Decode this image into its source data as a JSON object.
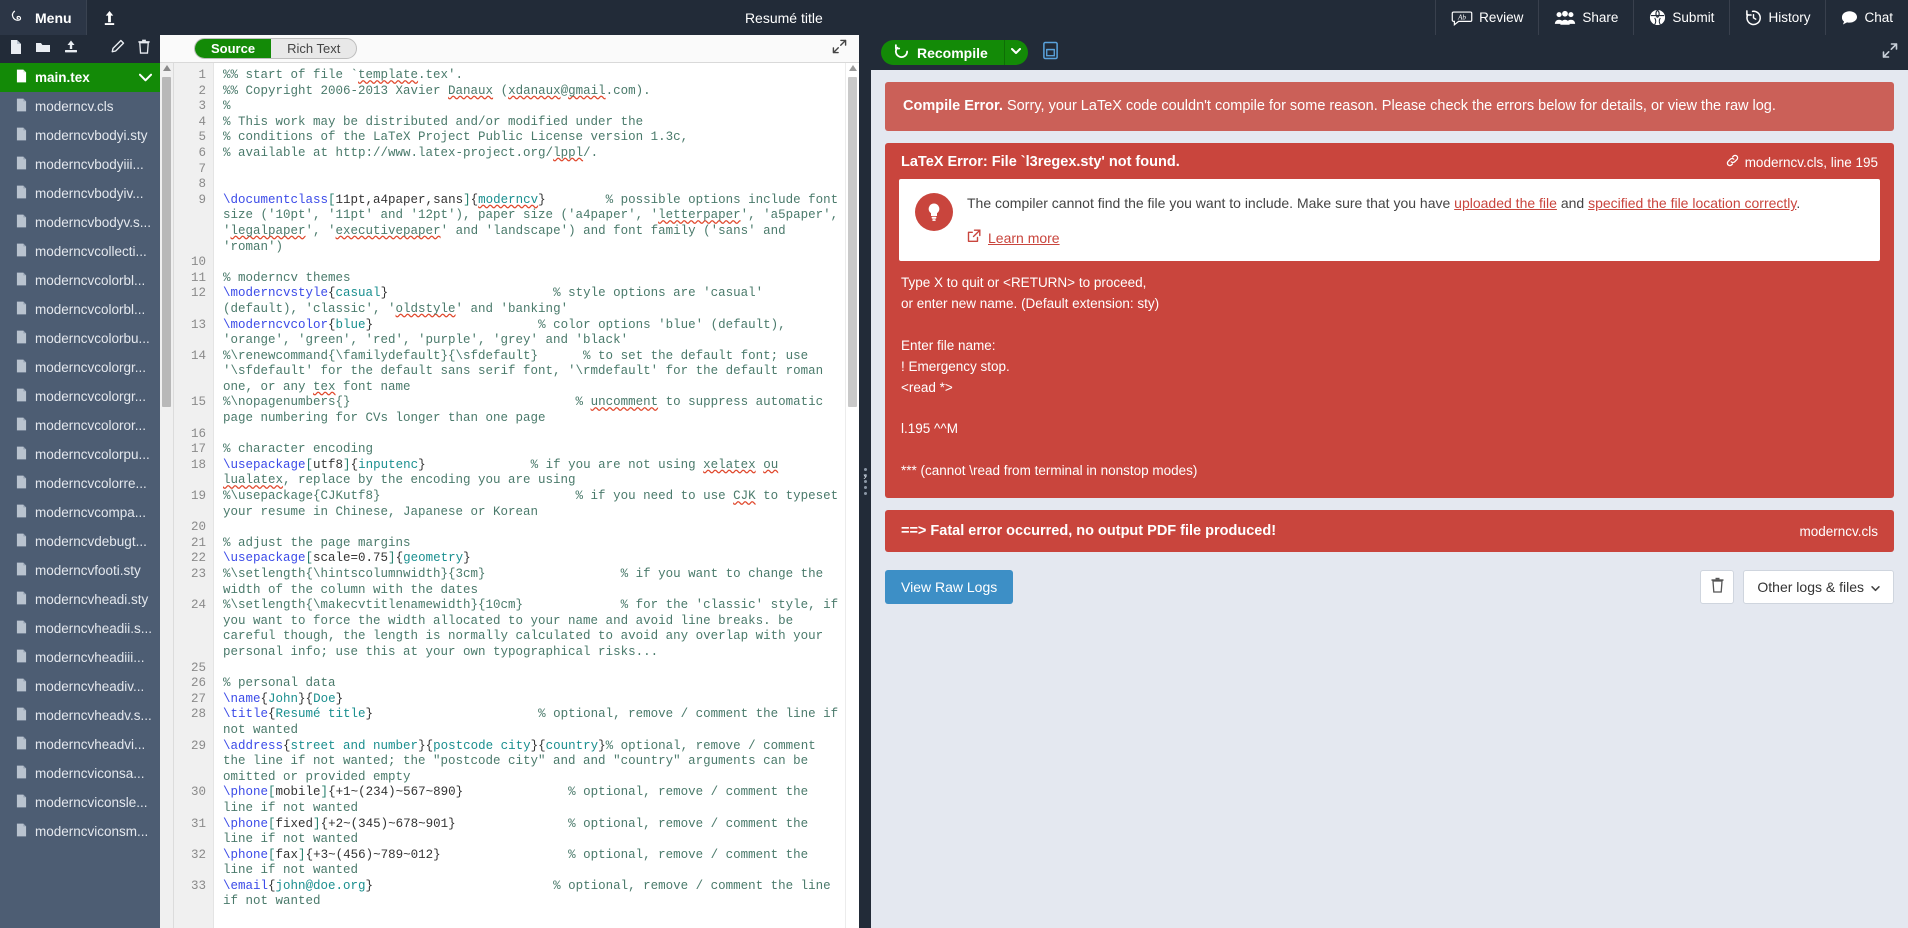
{
  "topnav": {
    "menu_label": "Menu",
    "back_icon": "upload-arrow-icon",
    "project_title": "Resumé title",
    "buttons": [
      {
        "label": "Review",
        "icon": "review-ab-icon"
      },
      {
        "label": "Share",
        "icon": "people-icon"
      },
      {
        "label": "Submit",
        "icon": "globe-icon"
      },
      {
        "label": "History",
        "icon": "history-clock-icon"
      },
      {
        "label": "Chat",
        "icon": "chat-bubble-icon"
      }
    ]
  },
  "filetree": {
    "toolbar": [
      {
        "icon": "new-file-icon"
      },
      {
        "icon": "new-folder-icon"
      },
      {
        "icon": "upload-icon"
      },
      {
        "icon": "rename-pencil-icon"
      },
      {
        "icon": "delete-trash-icon"
      }
    ],
    "items": [
      {
        "name": "main.tex",
        "selected": true
      },
      {
        "name": "moderncv.cls",
        "selected": false
      },
      {
        "name": "moderncvbodyi.sty",
        "selected": false
      },
      {
        "name": "moderncvbodyiii...",
        "selected": false
      },
      {
        "name": "moderncvbodyiv...",
        "selected": false
      },
      {
        "name": "moderncvbodyv.s...",
        "selected": false
      },
      {
        "name": "moderncvcollecti...",
        "selected": false
      },
      {
        "name": "moderncvcolorbl...",
        "selected": false
      },
      {
        "name": "moderncvcolorbl...",
        "selected": false
      },
      {
        "name": "moderncvcolorbu...",
        "selected": false
      },
      {
        "name": "moderncvcolorgr...",
        "selected": false
      },
      {
        "name": "moderncvcolorgr...",
        "selected": false
      },
      {
        "name": "moderncvcoloror...",
        "selected": false
      },
      {
        "name": "moderncvcolorpu...",
        "selected": false
      },
      {
        "name": "moderncvcolorre...",
        "selected": false
      },
      {
        "name": "moderncvcompa...",
        "selected": false
      },
      {
        "name": "moderncvdebugt...",
        "selected": false
      },
      {
        "name": "moderncvfooti.sty",
        "selected": false
      },
      {
        "name": "moderncvheadi.sty",
        "selected": false
      },
      {
        "name": "moderncvheadii.s...",
        "selected": false
      },
      {
        "name": "moderncvheadiii...",
        "selected": false
      },
      {
        "name": "moderncvheadiv...",
        "selected": false
      },
      {
        "name": "moderncvheadv.s...",
        "selected": false
      },
      {
        "name": "moderncvheadvi...",
        "selected": false
      },
      {
        "name": "moderncviconsa...",
        "selected": false
      },
      {
        "name": "moderncviconsle...",
        "selected": false
      },
      {
        "name": "moderncviconsm...",
        "selected": false
      }
    ]
  },
  "editor": {
    "mode_source": "Source",
    "mode_rich": "Rich Text",
    "active_mode": "Source",
    "expand_icon": "expand-diagonal-icon",
    "lines": [
      {
        "n": "1",
        "html": "<span class='cm-comment'>%% start of file `<span class='sp'>template</span>.tex'.</span>"
      },
      {
        "n": "2",
        "html": "<span class='cm-comment'>%% Copyright 2006-2013 Xavier <span class='sp'>Danaux</span> (<span class='sp'>xdanaux</span>@<span class='sp'>gmail</span>.com).</span>"
      },
      {
        "n": "3",
        "html": "<span class='cm-comment'>%</span>"
      },
      {
        "n": "4",
        "html": "<span class='cm-comment'>% This work may be distributed and/or modified under the</span>"
      },
      {
        "n": "5",
        "html": "<span class='cm-comment'>% conditions of the LaTeX Project Public License version 1.3c,</span>"
      },
      {
        "n": "6",
        "html": "<span class='cm-comment'>% available at http://www.latex-project.org/<span class='sp'>lppl</span>/.</span>"
      },
      {
        "n": "7",
        "html": ""
      },
      {
        "n": "8",
        "html": ""
      },
      {
        "n": "9",
        "html": "<span class='cm-tag'>\\documentclass</span><span class='cm-brk'>[</span>11pt,a4paper,sans<span class='cm-brk'>]</span>{<span class='cm-arg sp'>moderncv</span>}        <span class='cm-comment'>% possible options include font size ('10pt', '11pt' and '12pt'), paper size ('a4paper', '<span class='sp'>letterpaper</span>', 'a5paper', '<span class='sp'>legalpaper</span>', '<span class='sp'>executivepaper</span>' and 'landscape') and font family ('sans' and 'roman')</span>"
      },
      {
        "n": "10",
        "html": ""
      },
      {
        "n": "11",
        "html": "<span class='cm-comment'>% moderncv themes</span>"
      },
      {
        "n": "12",
        "html": "<span class='cm-tag'>\\moderncvstyle</span>{<span class='cm-arg'>casual</span>}                      <span class='cm-comment'>% style options are 'casual' (default), 'classic', '<span class='sp'>oldstyle</span>' and 'banking'</span>"
      },
      {
        "n": "13",
        "html": "<span class='cm-tag'>\\moderncvcolor</span>{<span class='cm-arg'>blue</span>}                      <span class='cm-comment'>% color options 'blue' (default), 'orange', 'green', 'red', 'purple', 'grey' and 'black'</span>"
      },
      {
        "n": "14",
        "html": "<span class='cm-comment'>%\\renewcommand{\\familydefault}{\\sfdefault}      % to set the default font; use '\\sfdefault' for the default sans serif font, '\\rmdefault' for the default roman one, or any <span class='sp'>tex</span> font name</span>"
      },
      {
        "n": "15",
        "html": "<span class='cm-comment'>%\\nopagenumbers{}                              % <span class='sp'>uncomment</span> to suppress automatic page numbering for CVs longer than one page</span>"
      },
      {
        "n": "16",
        "html": ""
      },
      {
        "n": "17",
        "html": "<span class='cm-comment'>% character encoding</span>"
      },
      {
        "n": "18",
        "html": "<span class='cm-tag'>\\usepackage</span><span class='cm-brk'>[</span>utf8<span class='cm-brk'>]</span>{<span class='cm-arg'>inputenc</span>}              <span class='cm-comment'>% if you are not using <span class='sp'>xelatex</span> <span class='sp'>ou</span> <span class='sp'>lualatex</span>, replace by the encoding you are using</span>"
      },
      {
        "n": "19",
        "html": "<span class='cm-comment'>%\\usepackage{CJKutf8}                          % if you need to use <span class='sp'>CJK</span> to typeset your resume in Chinese, Japanese or Korean</span>"
      },
      {
        "n": "20",
        "html": ""
      },
      {
        "n": "21",
        "html": "<span class='cm-comment'>% adjust the page margins</span>"
      },
      {
        "n": "22",
        "html": "<span class='cm-tag'>\\usepackage</span><span class='cm-brk'>[</span>scale=0.75<span class='cm-brk'>]</span>{<span class='cm-arg'>geometry</span>}"
      },
      {
        "n": "23",
        "html": "<span class='cm-comment'>%\\setlength{\\hintscolumnwidth}{3cm}                  % if you want to change the width of the column with the dates</span>"
      },
      {
        "n": "24",
        "html": "<span class='cm-comment'>%\\setlength{\\makecvtitlenamewidth}{10cm}             % for the 'classic' style, if you want to force the width allocated to your name and avoid line breaks. be careful though, the length is normally calculated to avoid any overlap with your personal info; use this at your own typographical risks...</span>"
      },
      {
        "n": "25",
        "html": ""
      },
      {
        "n": "26",
        "html": "<span class='cm-comment'>% personal data</span>"
      },
      {
        "n": "27",
        "html": "<span class='cm-tag'>\\name</span>{<span class='cm-arg'>John</span>}{<span class='cm-arg'>Doe</span>}"
      },
      {
        "n": "28",
        "html": "<span class='cm-tag'>\\title</span>{<span class='cm-arg'>Resumé title</span>}                      <span class='cm-comment'>% optional, remove / comment the line if not wanted</span>"
      },
      {
        "n": "29",
        "html": "<span class='cm-tag'>\\address</span>{<span class='cm-arg'>street and number</span>}{<span class='cm-arg'>postcode city</span>}{<span class='cm-arg'>country</span>}<span class='cm-comment'>% optional, remove / comment the line if not wanted; the \"postcode city\" and and \"country\" arguments can be omitted or provided empty</span>"
      },
      {
        "n": "30",
        "html": "<span class='cm-tag'>\\phone</span><span class='cm-brk'>[</span>mobile<span class='cm-brk'>]</span>{+1~(234)~567~890}              <span class='cm-comment'>% optional, remove / comment the line if not wanted</span>"
      },
      {
        "n": "31",
        "html": "<span class='cm-tag'>\\phone</span><span class='cm-brk'>[</span>fixed<span class='cm-brk'>]</span>{+2~(345)~678~901}               <span class='cm-comment'>% optional, remove / comment the line if not wanted</span>"
      },
      {
        "n": "32",
        "html": "<span class='cm-tag'>\\phone</span><span class='cm-brk'>[</span>fax<span class='cm-brk'>]</span>{+3~(456)~789~012}                 <span class='cm-comment'>% optional, remove / comment the line if not wanted</span>"
      },
      {
        "n": "33",
        "html": "<span class='cm-tag'>\\email</span>{<span class='cm-arg'>john@doe.org</span>}                        <span class='cm-comment'>% optional, remove / comment the line if not wanted</span>"
      }
    ]
  },
  "pdf_toolbar": {
    "recompile_label": "Recompile",
    "recompile_icon": "refresh-icon",
    "caret_icon": "chevron-down-icon",
    "pdf_icon": "pdf-file-icon",
    "expand_icon": "expand-diagonal-icon",
    "accent_green": "#138a07"
  },
  "logs": {
    "summary_title": "Compile Error.",
    "summary_text": " Sorry, your LaTeX code couldn't compile for some reason. Please check the errors below for details, or view the raw log.",
    "error": {
      "title": "LaTeX Error: File `l3regex.sty' not found.",
      "file_ref": "moderncv.cls, line 195",
      "file_icon": "link-icon",
      "hint_icon": "lightbulb-icon",
      "hint_pre": "The compiler cannot find the file you want to include. Make sure that you have ",
      "hint_link1": "uploaded the file",
      "hint_mid": " and ",
      "hint_link2": "specified the file location correctly",
      "hint_post": ".",
      "learn_more": "Learn more",
      "learn_more_icon": "external-link-icon",
      "raw": "Type X to quit or <RETURN> to proceed,\nor enter new name. (Default extension: sty)\n\nEnter file name:\n! Emergency stop.\n<read *>\n\nl.195 ^^M\n\n*** (cannot \\read from terminal in nonstop modes)"
    },
    "fatal_text": "==> Fatal error occurred, no output PDF file produced!",
    "fatal_file": "moderncv.cls",
    "view_raw_logs": "View Raw Logs",
    "clear_icon": "trash-icon",
    "other_logs": "Other logs & files",
    "other_logs_caret": "chevron-down-icon",
    "colors": {
      "summary_bg": "#cb6058",
      "error_bg": "#c9453d",
      "panel_bg": "#e4e8f0",
      "raw_button": "#3d8fc6"
    }
  }
}
